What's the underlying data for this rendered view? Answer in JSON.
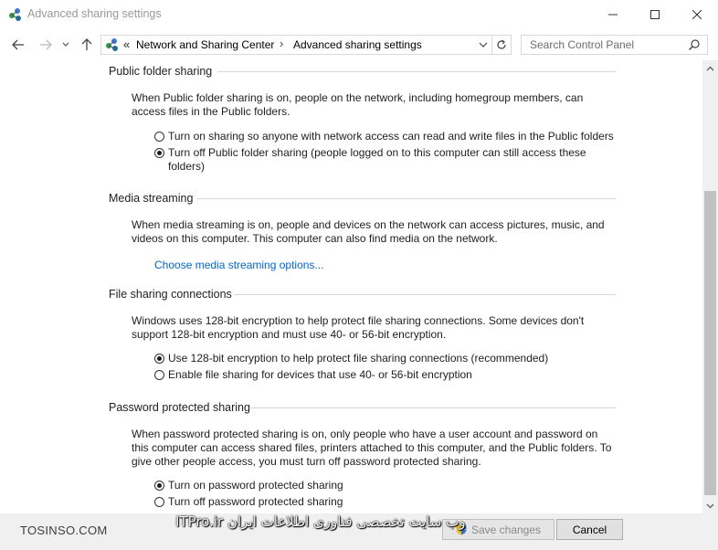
{
  "window": {
    "title": "Advanced sharing settings",
    "controls": {
      "minimize": "minimize",
      "maximize": "maximize",
      "close": "close"
    }
  },
  "address": {
    "overflow": "«",
    "crumbs": [
      "Network and Sharing Center",
      "Advanced sharing settings"
    ],
    "separator": "›"
  },
  "search": {
    "placeholder": "Search Control Panel"
  },
  "sections": {
    "public_folder": {
      "header": "Public folder sharing",
      "description": "When Public folder sharing is on, people on the network, including homegroup members, can access files in the Public folders.",
      "options": [
        {
          "label": "Turn on sharing so anyone with network access can read and write files in the Public folders",
          "checked": false
        },
        {
          "label": "Turn off Public folder sharing (people logged on to this computer can still access these folders)",
          "checked": true
        }
      ]
    },
    "media_streaming": {
      "header": "Media streaming",
      "description": "When media streaming is on, people and devices on the network can access pictures, music, and videos on this computer. This computer can also find media on the network.",
      "link": "Choose media streaming options..."
    },
    "file_sharing": {
      "header": "File sharing connections",
      "description": "Windows uses 128-bit encryption to help protect file sharing connections. Some devices don't support 128-bit encryption and must use 40- or 56-bit encryption.",
      "options": [
        {
          "label": "Use 128-bit encryption to help protect file sharing connections (recommended)",
          "checked": true
        },
        {
          "label": "Enable file sharing for devices that use 40- or 56-bit encryption",
          "checked": false
        }
      ]
    },
    "password": {
      "header": "Password protected sharing",
      "description": "When password protected sharing is on, only people who have a user account and password on this computer can access shared files, printers attached to this computer, and the Public folders. To give other people access, you must turn off password protected sharing.",
      "options": [
        {
          "label": "Turn on password protected sharing",
          "checked": true
        },
        {
          "label": "Turn off password protected sharing",
          "checked": false
        }
      ]
    }
  },
  "footer": {
    "save_label": "Save changes",
    "cancel_label": "Cancel"
  },
  "watermarks": {
    "left": "TOSINSO.COM",
    "right": "ITPro.ir وب سایت تخصصی فناوری اطلاعات ایران"
  },
  "colors": {
    "link": "#0066cc",
    "title_text": "#999999",
    "footer_bg": "#f0f0f0",
    "scroll_thumb": "#c1c1c1"
  },
  "icons": {
    "app": "network-sharing-icon",
    "back": "arrow-left-icon",
    "forward": "arrow-right-icon",
    "recent": "chevron-down-icon",
    "up": "arrow-up-icon",
    "refresh": "refresh-icon",
    "search": "search-icon",
    "shield": "uac-shield-icon"
  }
}
